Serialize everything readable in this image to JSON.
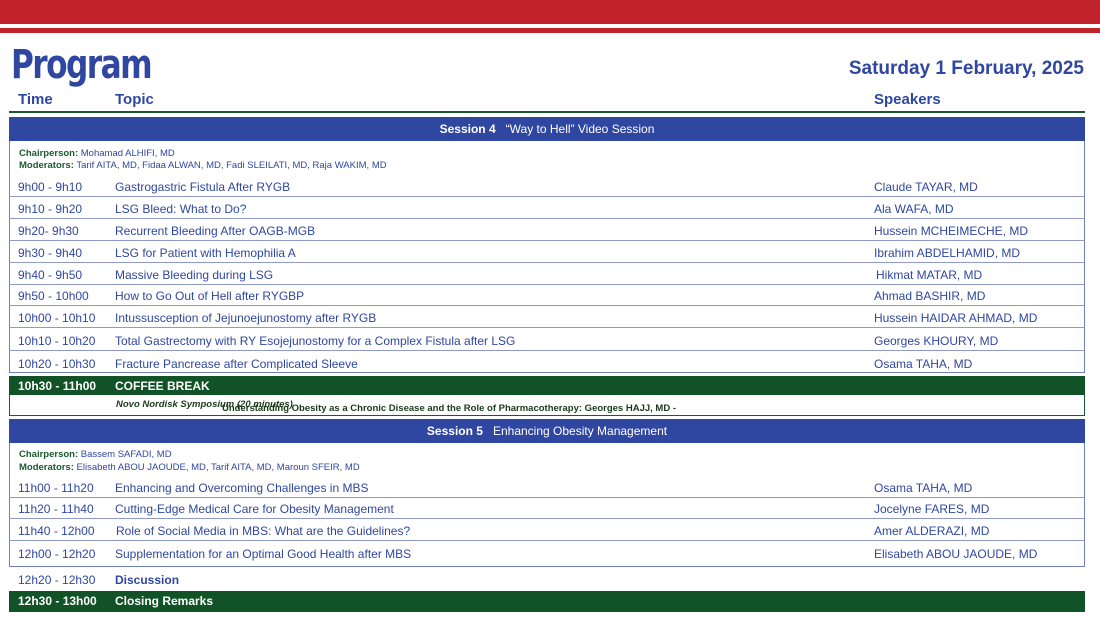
{
  "header": {
    "title": "Program",
    "date": "Saturday 1 February, 2025",
    "col_time": "Time",
    "col_topic": "Topic",
    "col_speakers": "Speakers"
  },
  "colors": {
    "red": "#c0232c",
    "blue": "#2f47a0",
    "green": "#115226"
  },
  "session4": {
    "label": "Session 4",
    "title": "“Way to Hell” Video Session",
    "chair_label": "Chairperson:",
    "chair": "Mohamad ALHIFI, MD",
    "mod_label": "Moderators:",
    "moderators": "Tarif AITA, MD, Fidaa ALWAN, MD, Fadi SLEILATI, MD, Raja WAKIM, MD",
    "rows": [
      {
        "time": "9h00 - 9h10",
        "topic": "Gastrogastric Fistula After RYGB",
        "speaker": "Claude TAYAR, MD"
      },
      {
        "time": "9h10 - 9h20",
        "topic": "LSG Bleed: What to Do?",
        "speaker": "Ala WAFA, MD"
      },
      {
        "time": "9h20- 9h30",
        "topic": "Recurrent Bleeding After OAGB-MGB",
        "speaker": "Hussein MCHEIMECHE, MD"
      },
      {
        "time": "9h30 - 9h40",
        "topic": "LSG for Patient with Hemophilia A",
        "speaker": "Ibrahim ABDELHAMID, MD"
      },
      {
        "time": "9h40 - 9h50",
        "topic": "Massive Bleeding during LSG",
        "speaker": "Hikmat MATAR, MD"
      },
      {
        "time": "9h50 - 10h00",
        "topic": "How to Go Out of Hell after RYGBP",
        "speaker": "Ahmad BASHIR, MD"
      },
      {
        "time": "10h00 - 10h10",
        "topic": "Intussusception of Jejunoejunostomy after RYGB",
        "speaker": "Hussein HAIDAR AHMAD, MD"
      },
      {
        "time": "10h10 - 10h20",
        "topic": "Total Gastrectomy with RY Esojejunostomy for a Complex Fistula after LSG",
        "speaker": "Georges KHOURY, MD"
      },
      {
        "time": "10h20 - 10h30",
        "topic": "Fracture Pancrease after Complicated Sleeve",
        "speaker": "Osama TAHA, MD"
      }
    ]
  },
  "coffee": {
    "time": "10h30 - 11h00",
    "label": "COFFEE BREAK",
    "symposium": "Understanding Obesity as a Chronic Disease and the Role of Pharmacotherapy: Georges HAJJ, MD -",
    "symposium_note": "Novo Nordisk Symposium (20 minutes)"
  },
  "session5": {
    "label": "Session 5",
    "title": "Enhancing Obesity Management",
    "chair_label": "Chairperson:",
    "chair": "Bassem SAFADI, MD",
    "mod_label": "Moderators:",
    "moderators": "Elisabeth ABOU JAOUDE, MD, Tarif AITA, MD, Maroun SFEIR, MD",
    "rows": [
      {
        "time": "11h00 - 11h20",
        "topic": "Enhancing and Overcoming Challenges in MBS",
        "speaker": "Osama TAHA, MD"
      },
      {
        "time": "11h20 - 11h40",
        "topic": "Cutting-Edge Medical Care for Obesity Management",
        "speaker": "Jocelyne FARES, MD"
      },
      {
        "time": "11h40 - 12h00",
        "topic": "Role of Social Media in MBS: What are the Guidelines?",
        "speaker": "Amer ALDERAZI, MD"
      },
      {
        "time": "12h00 - 12h20",
        "topic": "Supplementation for an Optimal Good Health after MBS",
        "speaker": "Elisabeth ABOU JAOUDE, MD"
      }
    ]
  },
  "discussion": {
    "time": "12h20 - 12h30",
    "label": "Discussion"
  },
  "closing": {
    "time": "12h30 - 13h00",
    "label": "Closing Remarks"
  }
}
